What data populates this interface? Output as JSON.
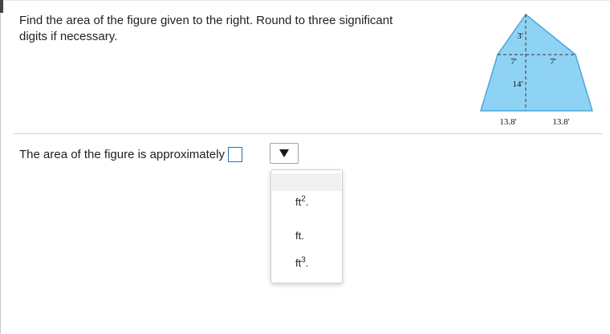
{
  "question": {
    "text_line1": "Find the area of the figure given to the right. Round to three significant",
    "text_line2": "digits if necessary."
  },
  "figure": {
    "labels": {
      "top_height": "3'",
      "half_width_left": "7'",
      "half_width_right": "7'",
      "trap_height": "14'",
      "slant_left": "13.8'",
      "slant_right": "13.8'"
    },
    "fill_color": "#8fd3f4",
    "stroke_color": "#4aa8d8"
  },
  "answer": {
    "prompt": "The area of the figure is approximately",
    "input_value": ""
  },
  "units_dropdown": {
    "options": [
      {
        "base": "ft",
        "exp": "2",
        "suffix": "."
      },
      {
        "base": "ft.",
        "exp": "",
        "suffix": ""
      },
      {
        "base": "ft",
        "exp": "3",
        "suffix": "."
      }
    ]
  }
}
